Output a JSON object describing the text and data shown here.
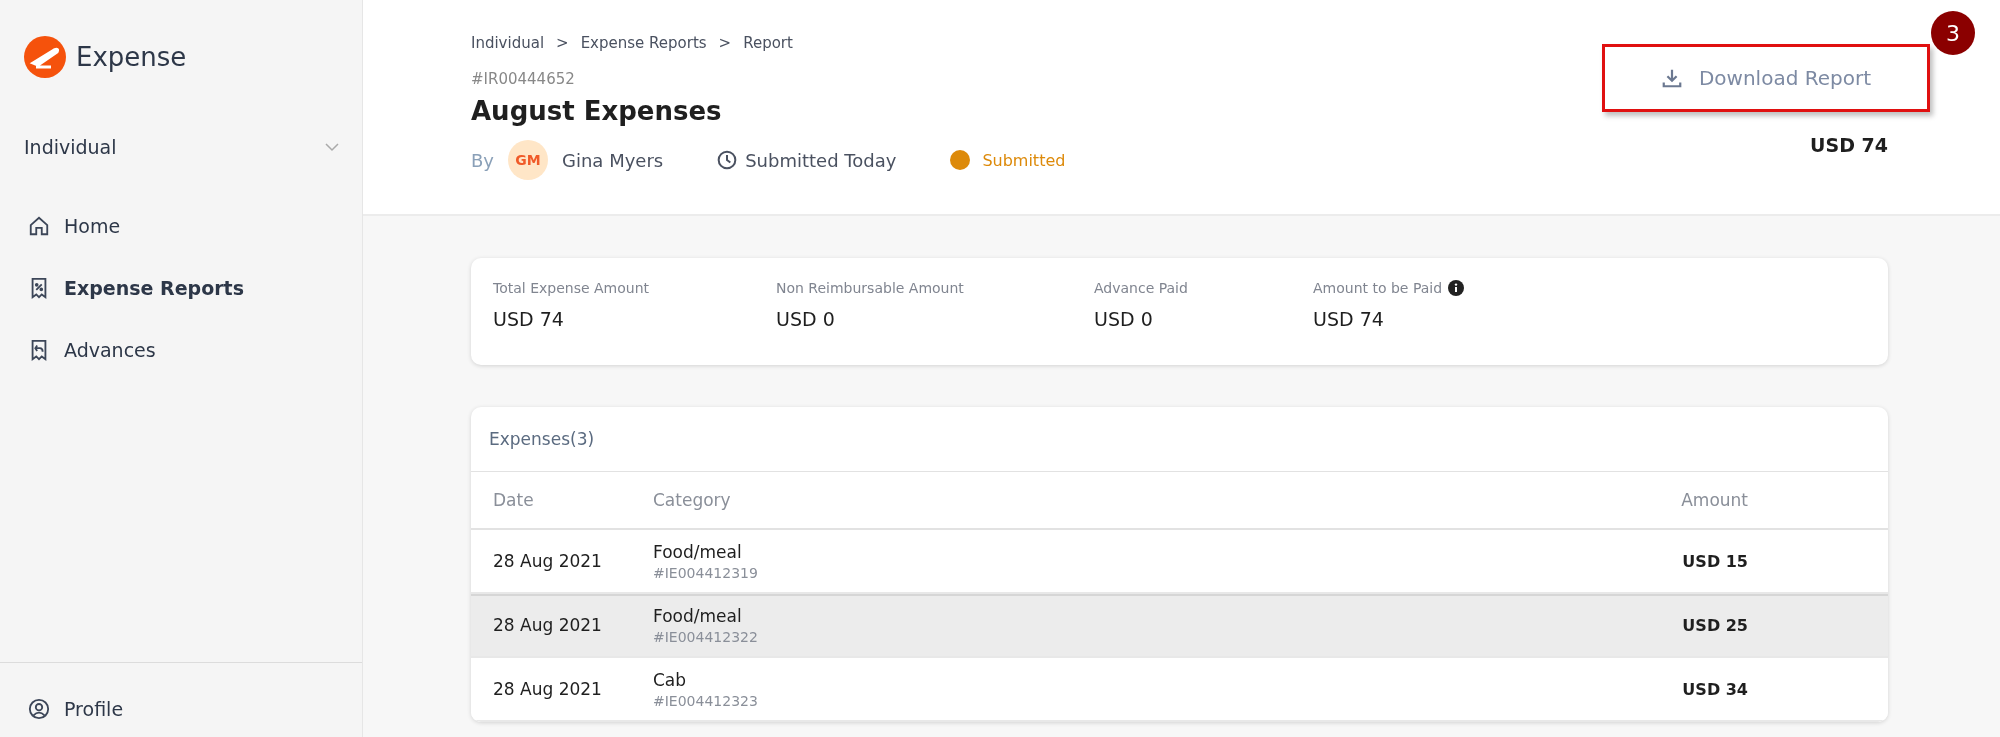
{
  "sidebar": {
    "brand": "Expense",
    "workspace": "Individual",
    "items": [
      {
        "label": "Home",
        "selected": false
      },
      {
        "label": "Expense Reports",
        "selected": true
      },
      {
        "label": "Advances",
        "selected": false
      }
    ],
    "footer_item": {
      "label": "Profile"
    }
  },
  "header": {
    "breadcrumb": [
      "Individual",
      "Expense Reports",
      "Report"
    ],
    "breadcrumb_separator": ">",
    "report_id": "#IR00444652",
    "title": "August Expenses",
    "by_label": "By",
    "avatar_initials": "GM",
    "owner": "Gina Myers",
    "submitted": "Submitted Today",
    "status": {
      "label": "Submitted",
      "color": "#dd8a0a"
    },
    "download_button": "Download Report",
    "annotation_step": "3",
    "total": "USD 74"
  },
  "summary": [
    {
      "label": "Total Expense Amount",
      "value": "USD 74",
      "info": false
    },
    {
      "label": "Non Reimbursable Amount",
      "value": "USD 0",
      "info": false
    },
    {
      "label": "Advance Paid",
      "value": "USD 0",
      "info": false
    },
    {
      "label": "Amount to be Paid",
      "value": "USD 74",
      "info": true
    }
  ],
  "expenses": {
    "title": "Expenses(3)",
    "columns": [
      "Date",
      "Category",
      "Amount"
    ],
    "rows": [
      {
        "date": "28 Aug 2021",
        "category": "Food/meal",
        "id": "#IE004412319",
        "amount": "USD 15",
        "highlighted": false
      },
      {
        "date": "28 Aug 2021",
        "category": "Food/meal",
        "id": "#IE004412322",
        "amount": "USD 25",
        "highlighted": true
      },
      {
        "date": "28 Aug 2021",
        "category": "Cab",
        "id": "#IE004412323",
        "amount": "USD 34",
        "highlighted": false
      }
    ]
  }
}
